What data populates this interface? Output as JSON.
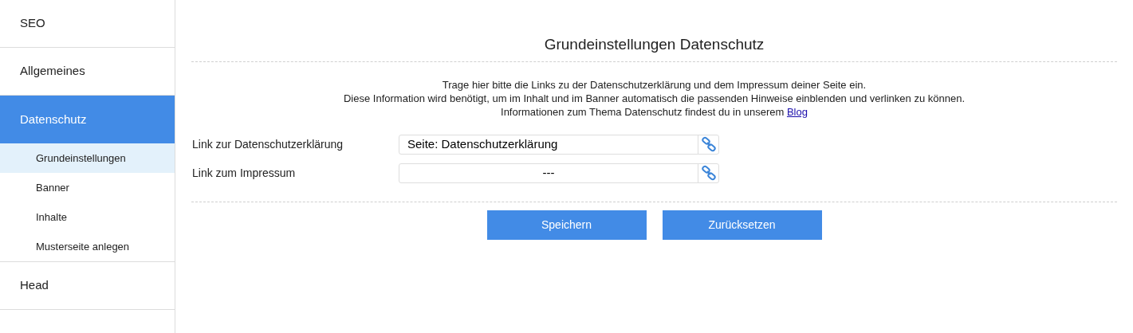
{
  "sidebar": {
    "items": [
      {
        "label": "SEO",
        "selected": false
      },
      {
        "label": "Allgemeines",
        "selected": false
      },
      {
        "label": "Datenschutz",
        "selected": true,
        "children": [
          {
            "label": "Grundeinstellungen",
            "selected": true
          },
          {
            "label": "Banner",
            "selected": false
          },
          {
            "label": "Inhalte",
            "selected": false
          },
          {
            "label": "Musterseite anlegen",
            "selected": false
          }
        ]
      },
      {
        "label": "Head",
        "selected": false
      }
    ]
  },
  "title": "Grundeinstellungen Datenschutz",
  "description": {
    "lines": [
      "Trage hier bitte die Links zu der Datenschutzerklärung und dem Impressum deiner Seite ein.",
      "Diese Information wird benötigt, um im Inhalt und im Banner automatisch die passenden Hinweise einblenden und verlinken zu können.",
      "Informationen zum Thema Datenschutz findest du in unserem"
    ],
    "link": "Blog"
  },
  "fields": [
    {
      "label": "Link zur Datenschutzerklärung",
      "value": "Seite: Datenschutzerklärung",
      "kind": "chosen"
    },
    {
      "label": "Link zum Impressum",
      "value": "---",
      "kind": "empty"
    }
  ],
  "buttons": [
    "Speichern",
    "Zurücksetzen"
  ]
}
